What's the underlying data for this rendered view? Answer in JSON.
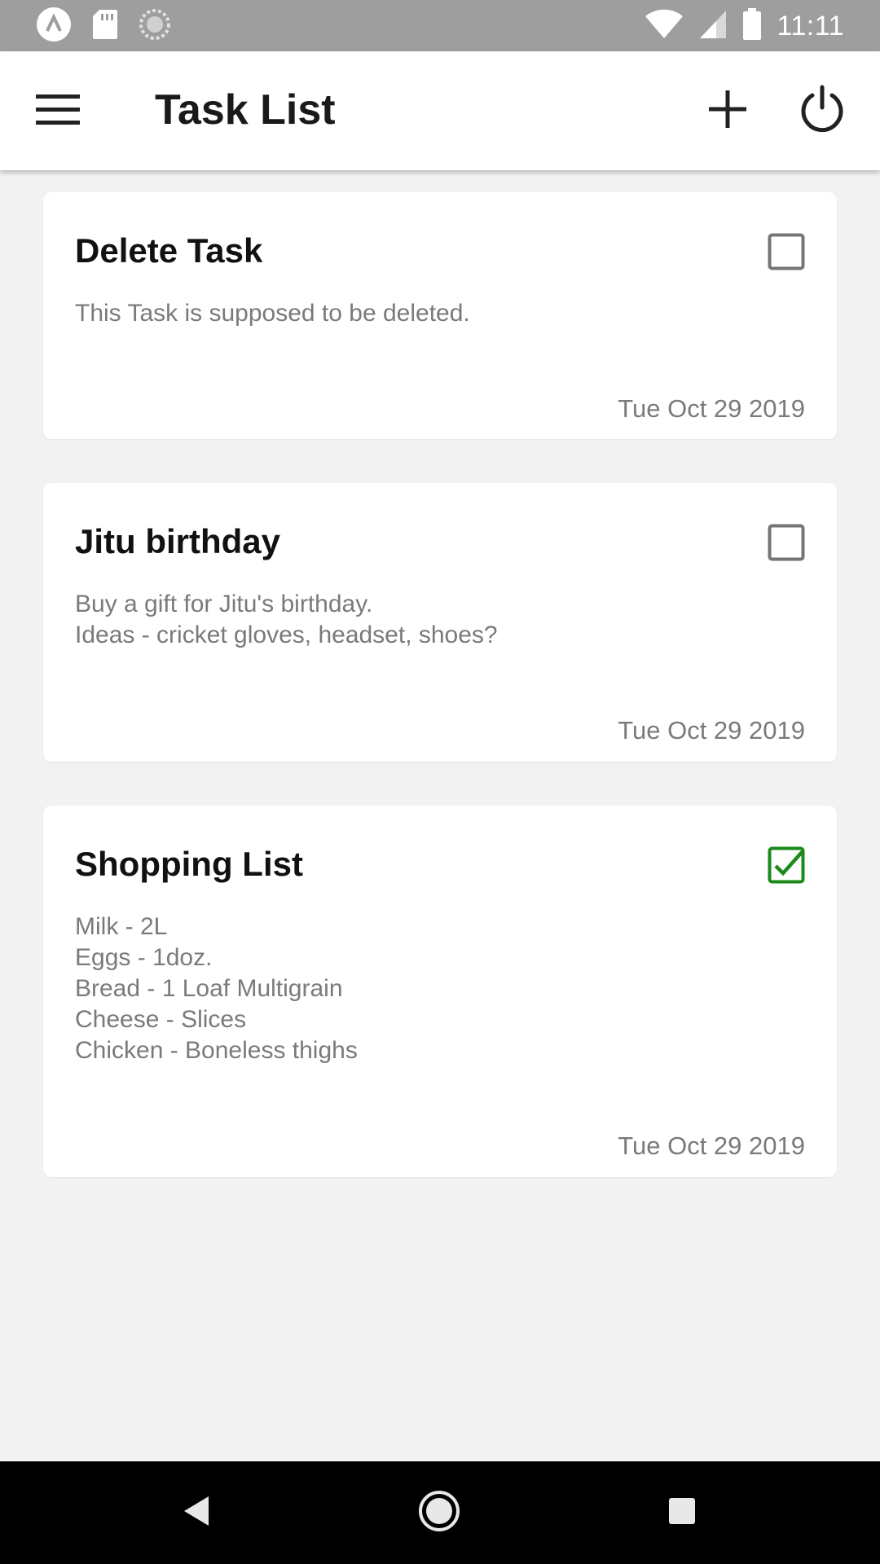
{
  "status_bar": {
    "time": "11:11",
    "left_icons": [
      "app-notification-icon",
      "sd-card-icon",
      "sync-icon"
    ],
    "right_icons": [
      "wifi-icon",
      "signal-icon",
      "battery-icon"
    ]
  },
  "app_bar": {
    "title": "Task List",
    "icons": {
      "menu": "hamburger-menu-icon",
      "add": "plus-icon",
      "power": "power-icon"
    }
  },
  "tasks": [
    {
      "title": "Delete Task",
      "description": "This Task is supposed to be deleted.",
      "date": "Tue Oct 29 2019",
      "checked": false
    },
    {
      "title": "Jitu birthday",
      "description": "Buy a gift for Jitu's birthday.\nIdeas - cricket gloves, headset, shoes?",
      "date": "Tue Oct 29 2019",
      "checked": false
    },
    {
      "title": "Shopping List",
      "description": "Milk - 2L\nEggs - 1doz.\nBread - 1 Loaf Multigrain\nCheese - Slices\nChicken - Boneless thighs",
      "date": "Tue Oct 29 2019",
      "checked": true
    }
  ],
  "colors": {
    "status_bar": "#9e9e9e",
    "app_bar": "#ffffff",
    "background": "#f2f2f2",
    "checkbox_unchecked": "#757575",
    "checkbox_checked": "#1a8a1a",
    "nav_bar": "#000000"
  },
  "nav_bar": {
    "icons": [
      "back-icon",
      "home-icon",
      "recents-icon"
    ]
  }
}
